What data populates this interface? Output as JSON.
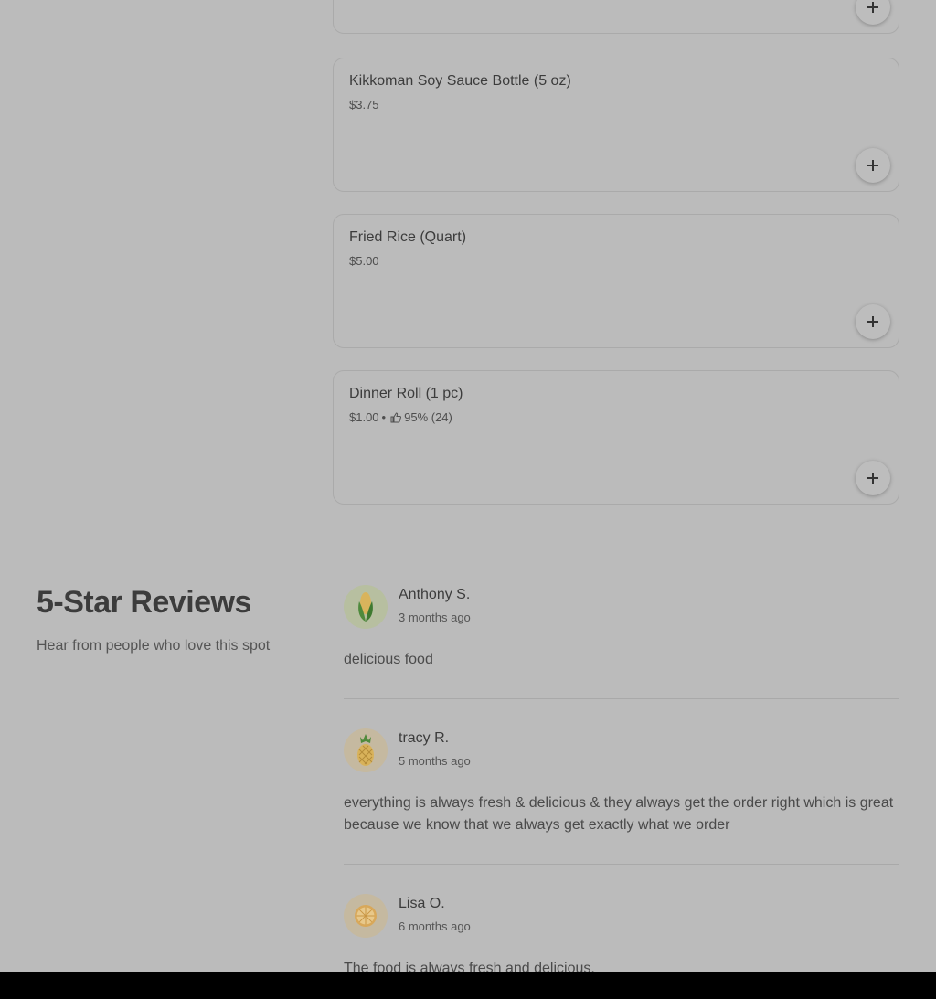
{
  "menu_items": [
    {
      "name": "",
      "price": "",
      "rating": ""
    },
    {
      "name": "Kikkoman Soy Sauce Bottle (5 oz)",
      "price": "$3.75",
      "rating": ""
    },
    {
      "name": "Fried Rice (Quart)",
      "price": "$5.00",
      "rating": ""
    },
    {
      "name": "Dinner Roll (1 pc)",
      "price": "$1.00",
      "rating": "95% (24)"
    }
  ],
  "reviews_section": {
    "heading": "5-Star Reviews",
    "subheading": "Hear from people who love this spot"
  },
  "reviews": [
    {
      "name": "Anthony S.",
      "date": "3 months ago",
      "text": "delicious food",
      "avatar_icon": "corn-icon",
      "avatar_bg": "#b7bfa0"
    },
    {
      "name": "tracy R.",
      "date": "5 months ago",
      "text": "everything is always fresh & delicious & they always get the order right which is great because we know that we always get exactly what we order",
      "avatar_icon": "pineapple-icon",
      "avatar_bg": "#c5b9a0"
    },
    {
      "name": "Lisa O.",
      "date": "6 months ago",
      "text": "The food is always fresh and delicious.",
      "avatar_icon": "orange-slice-icon",
      "avatar_bg": "#c5b9a0"
    }
  ],
  "icons": {
    "add": "plus-icon",
    "rating": "thumbs-up-icon"
  },
  "colors": {
    "background": "#bbbbbb",
    "bottom_bar": "#000000"
  }
}
